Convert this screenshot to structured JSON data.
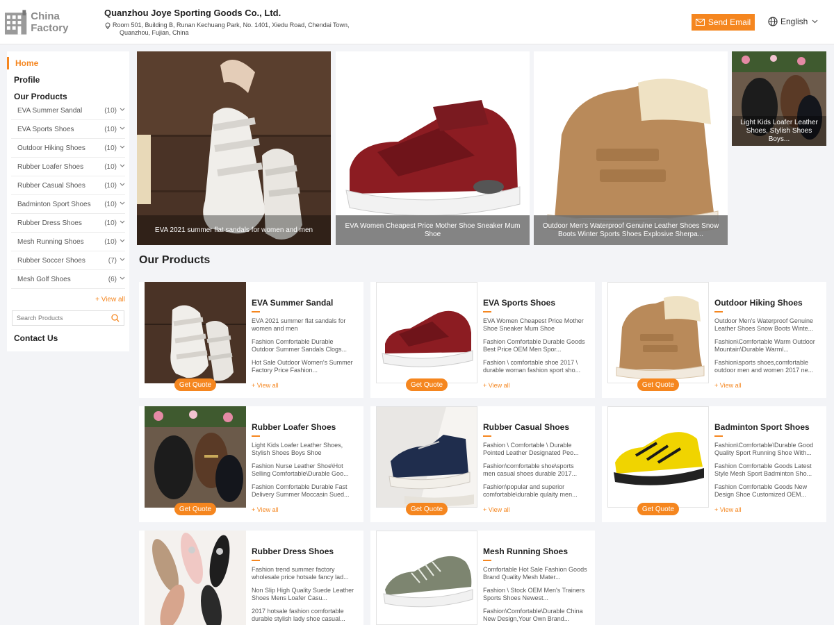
{
  "header": {
    "logo_text": "China Factory",
    "company_name": "Quanzhou Joye Sporting Goods Co., Ltd.",
    "address_line1": "Room 501, Building B, Runan Kechuang Park, No. 1401, Xiedu Road, Chendai Town,",
    "address_line2": "Quanzhou, Fujian, China",
    "send_email": "Send Email",
    "language": "English"
  },
  "sidebar": {
    "home": "Home",
    "profile": "Profile",
    "our_products": "Our Products",
    "categories": [
      {
        "label": "EVA Summer Sandal",
        "count": "(10)"
      },
      {
        "label": "EVA Sports Shoes",
        "count": "(10)"
      },
      {
        "label": "Outdoor Hiking Shoes",
        "count": "(10)"
      },
      {
        "label": "Rubber Loafer Shoes",
        "count": "(10)"
      },
      {
        "label": "Rubber Casual Shoes",
        "count": "(10)"
      },
      {
        "label": "Badminton Sport Shoes",
        "count": "(10)"
      },
      {
        "label": "Rubber Dress Shoes",
        "count": "(10)"
      },
      {
        "label": "Mesh Running Shoes",
        "count": "(10)"
      },
      {
        "label": "Rubber Soccer Shoes",
        "count": "(7)"
      },
      {
        "label": "Mesh Golf Shoes",
        "count": "(6)"
      }
    ],
    "view_all": "+ View all",
    "search_placeholder": "Search Products",
    "contact": "Contact Us"
  },
  "banners": [
    {
      "caption": "EVA 2021 summer flat sandals for women and men"
    },
    {
      "caption": "EVA Women Cheapest Price Mother Shoe Sneaker Mum Shoe"
    },
    {
      "caption": "Outdoor Men's Waterproof Genuine Leather Shoes Snow Boots Winter Sports Shoes Explosive Sherpa..."
    },
    {
      "caption": "Light Kids Loafer Leather Shoes, Stylish Shoes Boys..."
    }
  ],
  "section_title": "Our Products",
  "cards": [
    {
      "title": "EVA Summer Sandal",
      "descs": [
        "EVA 2021 summer flat sandals for women and men",
        "Fashion Comfortable Durable Outdoor Summer Sandals Clogs...",
        "Hot Sale Outdoor Women's Summer Factory Price Fashion..."
      ],
      "view": "+ View all",
      "quote": "Get Quote"
    },
    {
      "title": "EVA Sports Shoes",
      "descs": [
        "EVA Women Cheapest Price Mother Shoe Sneaker Mum Shoe",
        "Fashion Comfortable Durable Goods Best Price OEM Men Spor...",
        "Fashion \\ comfortable shoe 2017 \\ durable woman fashion sport sho..."
      ],
      "view": "+ View all",
      "quote": "Get Quote"
    },
    {
      "title": "Outdoor Hiking Shoes",
      "descs": [
        "Outdoor Men's Waterproof Genuine Leather Shoes Snow Boots Winte...",
        "Fashion\\Comfortable Warm Outdoor Mountain\\Durable Warml...",
        "Fashion\\sports shoes,comfortable outdoor men and women 2017 ne..."
      ],
      "view": "+ View all",
      "quote": "Get Quote"
    },
    {
      "title": "Rubber Loafer Shoes",
      "descs": [
        "Light Kids Loafer Leather Shoes, Stylish Shoes Boys Shoe",
        "Fashion Nurse Leather Shoe\\Hot Selling Comfortable\\Durable Goo...",
        "Fashion Comfortable Durable Fast Delivery Summer Moccasin Sued..."
      ],
      "view": "+ View all",
      "quote": "Get Quote"
    },
    {
      "title": "Rubber Casual Shoes",
      "descs": [
        "Fashion \\ Comfortable \\ Durable Pointed Leather Designated Peo...",
        "Fashion\\comfortable shoe\\sports men casual shoes durable 2017...",
        "Fashion\\popular and superior comfortable\\durable qulaity men..."
      ],
      "view": "+ View all",
      "quote": "Get Quote"
    },
    {
      "title": "Badminton Sport Shoes",
      "descs": [
        "Fashion\\Comfortable\\Durable Good Quality Sport Running Shoe With...",
        "Fashion Comfortable Goods Latest Style Mesh Sport Badminton Sho...",
        "Fashion Comfortable Goods New Design Shoe Customized OEM..."
      ],
      "view": "+ View all",
      "quote": "Get Quote"
    },
    {
      "title": "Rubber Dress Shoes",
      "descs": [
        "Fashion trend summer factory wholesale price hotsale fancy lad...",
        "Non Slip High Quality Suede Leather Shoes Mens Loafer Casu...",
        "2017 hotsale fashion comfortable durable stylish lady shoe casual..."
      ],
      "view": "",
      "quote": ""
    },
    {
      "title": "Mesh Running Shoes",
      "descs": [
        "Comfortable Hot Sale Fashion Goods Brand Quality Mesh Mater...",
        "Fashion \\ Stock OEM Men's Trainers Sports Shoes Newest...",
        "Fashion\\Comfortable\\Durable China New Design,Your Own Brand..."
      ],
      "view": "",
      "quote": ""
    }
  ],
  "colors": {
    "accent": "#f5861f"
  }
}
